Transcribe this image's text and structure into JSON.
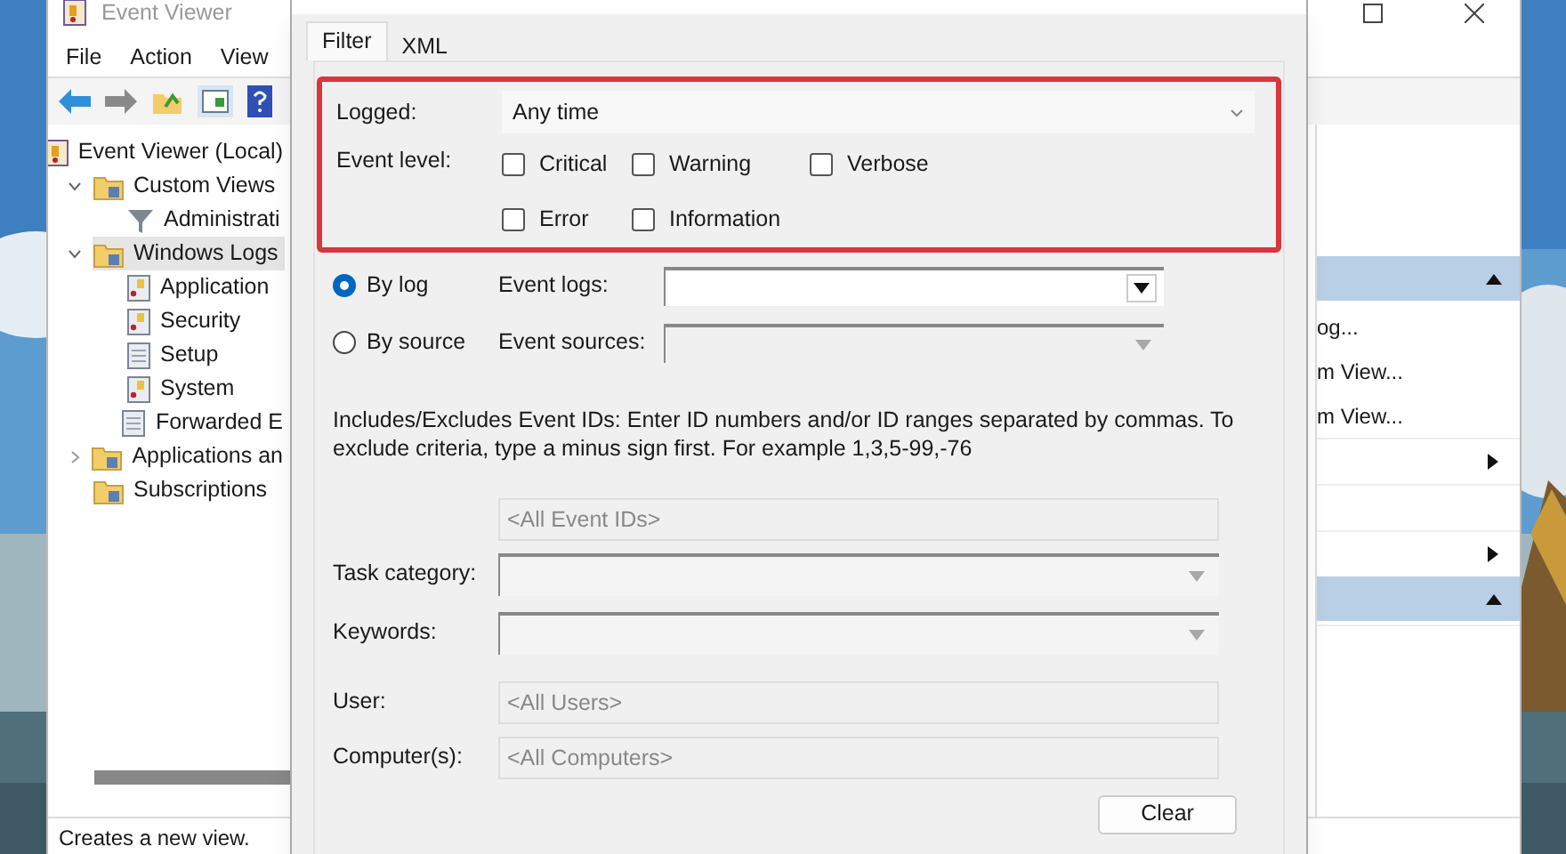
{
  "window": {
    "title": "Event Viewer",
    "menu": [
      "File",
      "Action",
      "View"
    ]
  },
  "tree": [
    {
      "label": "Event Viewer (Local)",
      "kind": "viewer",
      "selected": false,
      "children": [
        {
          "label": "Custom Views",
          "kind": "folder",
          "selected": false,
          "expanded": true,
          "children": [
            {
              "label": "Administrati",
              "kind": "filter",
              "selected": false
            }
          ]
        },
        {
          "label": "Windows Logs",
          "kind": "folder",
          "selected": true,
          "expanded": true,
          "children": [
            {
              "label": "Application",
              "kind": "log",
              "selected": false
            },
            {
              "label": "Security",
              "kind": "log",
              "selected": false
            },
            {
              "label": "Setup",
              "kind": "plain",
              "selected": false
            },
            {
              "label": "System",
              "kind": "log",
              "selected": false
            },
            {
              "label": "Forwarded E",
              "kind": "plain",
              "selected": false
            }
          ]
        },
        {
          "label": "Applications an",
          "kind": "folder",
          "selected": false,
          "expanded": false
        },
        {
          "label": "Subscriptions",
          "kind": "folder",
          "selected": false
        }
      ]
    }
  ],
  "actions": [
    {
      "kind": "header"
    },
    {
      "kind": "item",
      "label": "og..."
    },
    {
      "kind": "item",
      "label": "m View..."
    },
    {
      "kind": "item",
      "label": "m View..."
    },
    {
      "kind": "submenu"
    },
    {
      "kind": "blank"
    },
    {
      "kind": "submenu"
    },
    {
      "kind": "header"
    },
    {
      "kind": "blank"
    }
  ],
  "status_bar": "Creates a new view.",
  "dialog": {
    "tabs": [
      {
        "label": "Filter",
        "selected": true
      },
      {
        "label": "XML",
        "selected": false
      }
    ],
    "logged": {
      "label": "Logged:",
      "value": "Any time"
    },
    "event_level": {
      "label": "Event level:",
      "options": [
        {
          "label": "Critical",
          "checked": false
        },
        {
          "label": "Warning",
          "checked": false
        },
        {
          "label": "Verbose",
          "checked": false
        },
        {
          "label": "Error",
          "checked": false
        },
        {
          "label": "Information",
          "checked": false
        }
      ]
    },
    "sources": [
      {
        "label": "By log",
        "selected": true,
        "field_label": "Event logs:",
        "disabled": false
      },
      {
        "label": "By source",
        "selected": false,
        "field_label": "Event sources:",
        "disabled": true
      }
    ],
    "description": "Includes/Excludes Event IDs: Enter ID numbers and/or ID ranges separated by commas. To exclude criteria, type a minus sign first. For example 1,3,5-99,-76",
    "event_ids": {
      "placeholder": "<All Event IDs>"
    },
    "task_category": {
      "label": "Task category:"
    },
    "keywords": {
      "label": "Keywords:"
    },
    "user": {
      "label": "User:",
      "placeholder": "<All Users>"
    },
    "computers": {
      "label": "Computer(s):",
      "placeholder": "<All Computers>"
    },
    "clear_button": "Clear"
  }
}
